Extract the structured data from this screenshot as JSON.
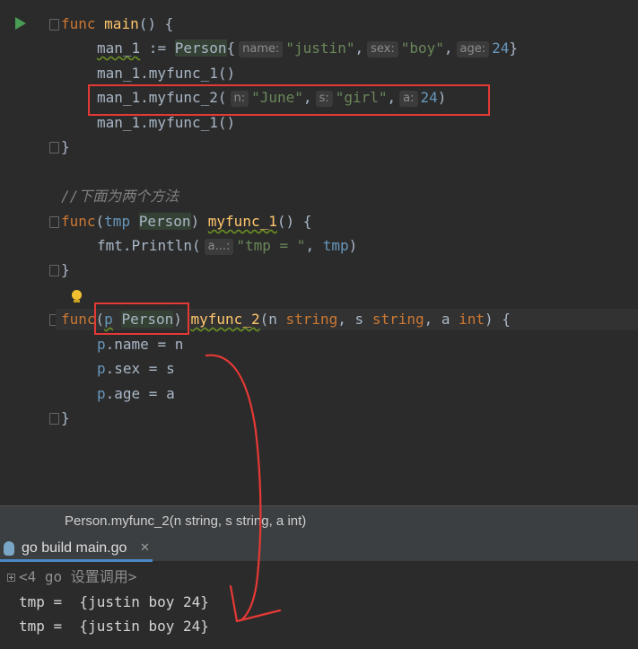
{
  "editor": {
    "l1": {
      "kw": "func",
      "name": "main",
      "rest": "() {"
    },
    "l2": {
      "var": "man_1",
      "op": " := ",
      "type": "Person",
      "brace": "{",
      "h1": "name:",
      "v1": "\"justin\"",
      "c1": ",",
      "h2": "sex:",
      "v2": "\"boy\"",
      "c2": ",",
      "h3": "age:",
      "v3": "24",
      "end": "}"
    },
    "l3": {
      "text": "man_1.myfunc_1()"
    },
    "l4": {
      "pre": "man_1.myfunc_2(",
      "h1": "n:",
      "v1": "\"June\"",
      "c1": ",",
      "h2": "s:",
      "v2": "\"girl\"",
      "c2": ",",
      "h3": "a:",
      "v3": "24",
      "end": ")"
    },
    "l5": {
      "text": "man_1.myfunc_1()"
    },
    "l6": {
      "text": "}"
    },
    "l8": {
      "text": "//下面为两个方法"
    },
    "l9": {
      "kw": "func",
      "p1": "(",
      "recv": "tmp",
      "sp": " ",
      "type": "Person",
      "p2": ") ",
      "name": "myfunc_1",
      "rest": "() {"
    },
    "l10": {
      "pkg": "fmt",
      "dot": ".",
      "fn": "Println",
      "open": "(",
      "hint": "a...:",
      "str": "\"tmp = \"",
      "comma": ", ",
      "arg": "tmp",
      "close": ")"
    },
    "l11": {
      "text": "}"
    },
    "l13": {
      "kw": "func",
      "p1": "(",
      "recv": "p",
      "sp": " ",
      "type": "Person",
      "p2": ") ",
      "name": "myfunc_2",
      "args1": "(n ",
      "t1": "string",
      ", ": "",
      "sep1": ", s ",
      "t2": "string",
      "sep2": ", a ",
      "t3": "int",
      "rest": ") {"
    },
    "l14": {
      "a": "p",
      "b": ".name = n"
    },
    "l15": {
      "a": "p",
      "b": ".sex = s"
    },
    "l16": {
      "a": "p",
      "b": ".age = a"
    },
    "l17": {
      "text": "}"
    }
  },
  "tooltip": {
    "text": "Person.myfunc_2(n string, s string, a int)"
  },
  "run_tab": {
    "title": "go build main.go",
    "close": "✕",
    "icon": "gopher-icon"
  },
  "console": {
    "header": "<4 go 设置调用>",
    "out1": "tmp =  {justin boy 24}",
    "out2": "tmp =  {justin boy 24}"
  },
  "colors": {
    "accent_red": "#e53935",
    "run_green": "#499c54",
    "keyword": "#cc7832",
    "string": "#6a8759",
    "number": "#6897bb"
  }
}
